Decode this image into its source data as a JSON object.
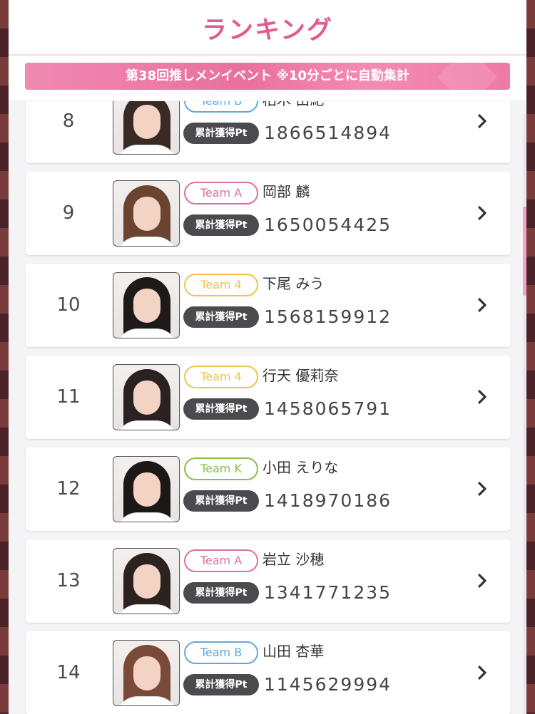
{
  "header": {
    "title": "ランキング",
    "event_banner": "第38回推しメンイベント ※10分ごとに自動集計"
  },
  "colors": {
    "title_pink": "#e15c8e",
    "banner_pink": "#ee7aa6",
    "team_b": "#5fa8dd",
    "team_a": "#df6fa1",
    "team_4": "#eec34e",
    "team_k": "#86bf4a",
    "pt_label_bg": "#4a4a4f"
  },
  "pt_label": "累計獲得Pt",
  "rankings": [
    {
      "rank": "8",
      "team": "Team B",
      "team_key": "team_b",
      "name": "柏木 由紀",
      "points": "1866514894",
      "hair": "#3a2a24"
    },
    {
      "rank": "9",
      "team": "Team A",
      "team_key": "team_a",
      "name": "岡部 麟",
      "points": "1650054425",
      "hair": "#6b4331"
    },
    {
      "rank": "10",
      "team": "Team 4",
      "team_key": "team_4",
      "name": "下尾 みう",
      "points": "1568159912",
      "hair": "#1f1a1a"
    },
    {
      "rank": "11",
      "team": "Team 4",
      "team_key": "team_4",
      "name": "行天 優莉奈",
      "points": "1458065791",
      "hair": "#2a2220"
    },
    {
      "rank": "12",
      "team": "Team K",
      "team_key": "team_k",
      "name": "小田 えりな",
      "points": "1418970186",
      "hair": "#1c1818"
    },
    {
      "rank": "13",
      "team": "Team A",
      "team_key": "team_a",
      "name": "岩立 沙穂",
      "points": "1341771235",
      "hair": "#2c2220"
    },
    {
      "rank": "14",
      "team": "Team B",
      "team_key": "team_b",
      "name": "山田 杏華",
      "points": "1145629994",
      "hair": "#7a4a38"
    }
  ]
}
